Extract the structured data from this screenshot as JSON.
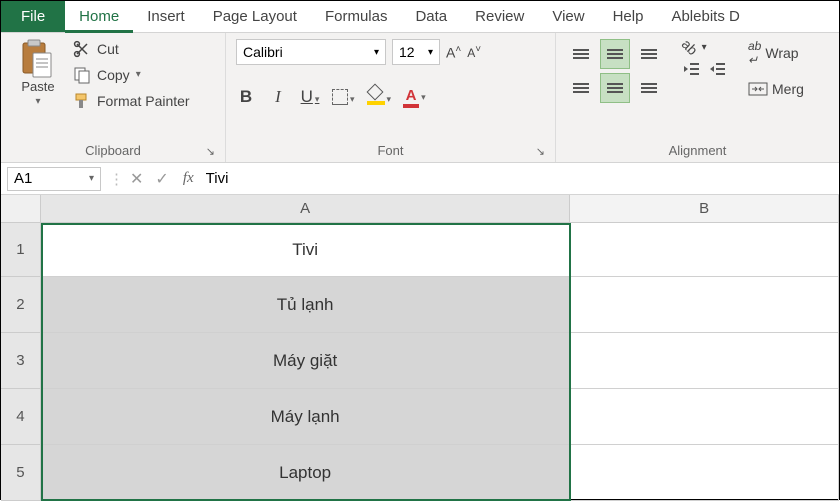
{
  "menu": {
    "file": "File",
    "home": "Home",
    "insert": "Insert",
    "pageLayout": "Page Layout",
    "formulas": "Formulas",
    "data": "Data",
    "review": "Review",
    "view": "View",
    "help": "Help",
    "ablebits": "Ablebits D"
  },
  "ribbon": {
    "clipboard": {
      "paste": "Paste",
      "cut": "Cut",
      "copy": "Copy",
      "formatPainter": "Format Painter",
      "label": "Clipboard"
    },
    "font": {
      "family": "Calibri",
      "size": "12",
      "label": "Font"
    },
    "alignment": {
      "wrap": "Wrap",
      "merge": "Merg",
      "label": "Alignment"
    }
  },
  "formulabar": {
    "nameBox": "A1",
    "value": "Tivi"
  },
  "grid": {
    "cols": {
      "A": "A",
      "B": "B"
    },
    "rows": {
      "1": {
        "h": "1",
        "A": "Tivi"
      },
      "2": {
        "h": "2",
        "A": "Tủ lạnh"
      },
      "3": {
        "h": "3",
        "A": "Máy giặt"
      },
      "4": {
        "h": "4",
        "A": "Máy lạnh"
      },
      "5": {
        "h": "5",
        "A": "Laptop"
      }
    }
  }
}
